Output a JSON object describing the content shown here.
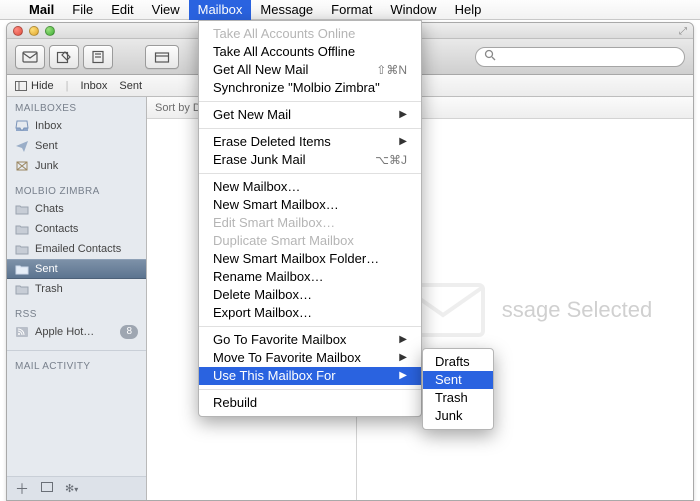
{
  "menubar": {
    "appname": "Mail",
    "items": [
      "File",
      "Edit",
      "View",
      "Mailbox",
      "Message",
      "Format",
      "Window",
      "Help"
    ],
    "active_index": 3
  },
  "toolbar": {
    "search_placeholder": ""
  },
  "favbar": {
    "hide": "Hide",
    "items": [
      "Inbox",
      "Sent"
    ]
  },
  "sidebar": {
    "section_mailboxes": "MAILBOXES",
    "mailboxes": [
      "Inbox",
      "Sent",
      "Junk"
    ],
    "section_account": "MOLBIO ZIMBRA",
    "account_items": [
      "Chats",
      "Contacts",
      "Emailed Contacts",
      "Sent",
      "Trash"
    ],
    "account_selected_index": 3,
    "section_rss": "RSS",
    "rss_items": [
      {
        "label": "Apple Hot…",
        "badge": "8"
      }
    ],
    "section_activity": "MAIL ACTIVITY"
  },
  "sortbar": {
    "label": "Sort by Da"
  },
  "preview": {
    "text": "ssage Selected"
  },
  "menu": {
    "groups": [
      [
        {
          "label": "Take All Accounts Online",
          "disabled": true
        },
        {
          "label": "Take All Accounts Offline"
        },
        {
          "label": "Get All New Mail",
          "shortcut": "⇧⌘N"
        },
        {
          "label": "Synchronize \"Molbio Zimbra\""
        }
      ],
      [
        {
          "label": "Get New Mail",
          "submenu": true
        }
      ],
      [
        {
          "label": "Erase Deleted Items",
          "submenu": true
        },
        {
          "label": "Erase Junk Mail",
          "shortcut": "⌥⌘J"
        }
      ],
      [
        {
          "label": "New Mailbox…"
        },
        {
          "label": "New Smart Mailbox…"
        },
        {
          "label": "Edit Smart Mailbox…",
          "disabled": true
        },
        {
          "label": "Duplicate Smart Mailbox",
          "disabled": true
        },
        {
          "label": "New Smart Mailbox Folder…"
        },
        {
          "label": "Rename Mailbox…"
        },
        {
          "label": "Delete Mailbox…"
        },
        {
          "label": "Export Mailbox…"
        }
      ],
      [
        {
          "label": "Go To Favorite Mailbox",
          "submenu": true
        },
        {
          "label": "Move To Favorite Mailbox",
          "submenu": true
        },
        {
          "label": "Use This Mailbox For",
          "submenu": true,
          "highlight": true
        }
      ],
      [
        {
          "label": "Rebuild"
        }
      ]
    ],
    "submenu": {
      "items": [
        "Drafts",
        "Sent",
        "Trash",
        "Junk"
      ],
      "highlight_index": 1
    }
  }
}
